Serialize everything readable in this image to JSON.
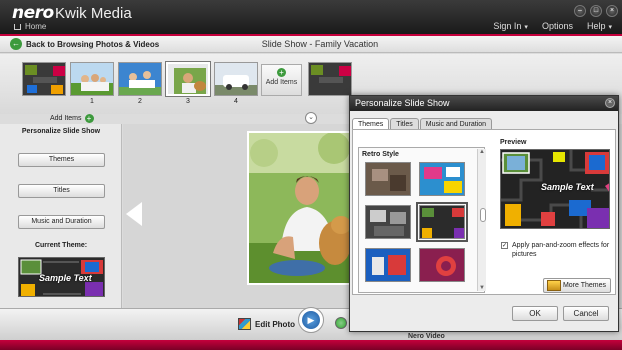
{
  "app": {
    "logo": "nero",
    "name": "Kwik Media",
    "home": "Home",
    "nav": [
      "Sign In",
      "Options",
      "Help"
    ],
    "nav_caret": "▾",
    "window_buttons": [
      "minimize-icon",
      "maximize-icon",
      "close-icon"
    ]
  },
  "breadcrumb": {
    "back_label": "Back to Browsing Photos & Videos",
    "title": "Slide Show - Family Vacation"
  },
  "filmstrip": {
    "frames": [
      {
        "number": ""
      },
      {
        "number": "1"
      },
      {
        "number": "2"
      },
      {
        "number": "3"
      },
      {
        "number": "4"
      }
    ],
    "add_items_tile": "Add Items",
    "add_items_tab": "Add Items"
  },
  "left_panel": {
    "title": "Personalize Slide Show",
    "buttons": [
      "Themes",
      "Titles",
      "Music and Duration"
    ],
    "current_theme_label": "Current Theme:",
    "sample_text": "Sample Text"
  },
  "bottom": {
    "edit_photo": "Edit Photo",
    "nero_video": "Nero Video"
  },
  "dialog": {
    "title": "Personalize Slide Show",
    "tabs": [
      "Themes",
      "Titles",
      "Music and Duration"
    ],
    "active_tab": "Themes",
    "style_group": "Retro Style",
    "preview_label": "Preview",
    "preview_sample_text": "Sample Text",
    "pan_zoom_label": "Apply pan-and-zoom effects for pictures",
    "pan_zoom_checked": true,
    "more_themes": "More Themes",
    "ok": "OK",
    "cancel": "Cancel"
  },
  "colors": {
    "accent": "#c5003c",
    "add_green": "#3d9a3d"
  }
}
